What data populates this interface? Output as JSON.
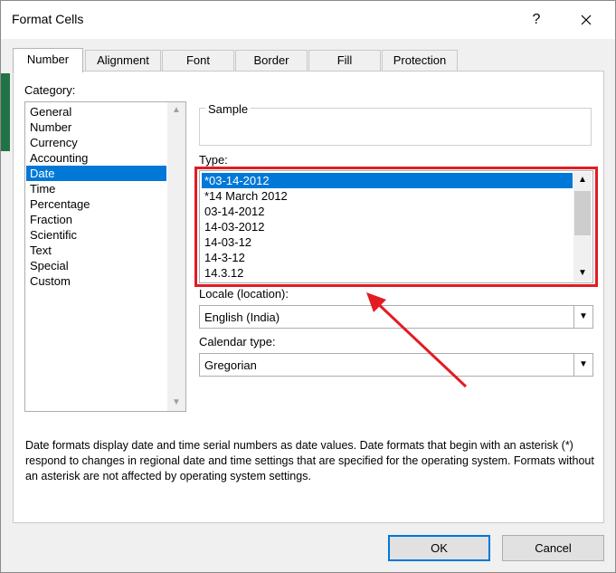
{
  "dialog": {
    "title": "Format Cells",
    "help": "?",
    "close": "✕"
  },
  "tabs": [
    "Number",
    "Alignment",
    "Font",
    "Border",
    "Fill",
    "Protection"
  ],
  "category": {
    "label": "Category:",
    "items": [
      "General",
      "Number",
      "Currency",
      "Accounting",
      "Date",
      "Time",
      "Percentage",
      "Fraction",
      "Scientific",
      "Text",
      "Special",
      "Custom"
    ],
    "selected": "Date"
  },
  "sample": {
    "label": "Sample"
  },
  "type": {
    "label": "Type:",
    "items": [
      "*03-14-2012",
      "*14 March 2012",
      "03-14-2012",
      "14-03-2012",
      "14-03-12",
      "14-3-12",
      "14.3.12"
    ],
    "selected": "*03-14-2012"
  },
  "locale": {
    "label": "Locale (location):",
    "value": "English (India)"
  },
  "calendar": {
    "label": "Calendar type:",
    "value": "Gregorian"
  },
  "description": "Date formats display date and time serial numbers as date values.  Date formats that begin with an asterisk (*) respond to changes in regional date and time settings that are specified for the operating system. Formats without an asterisk are not affected by operating system settings.",
  "buttons": {
    "ok": "OK",
    "cancel": "Cancel"
  },
  "annotation": {
    "color": "#e31b23"
  }
}
